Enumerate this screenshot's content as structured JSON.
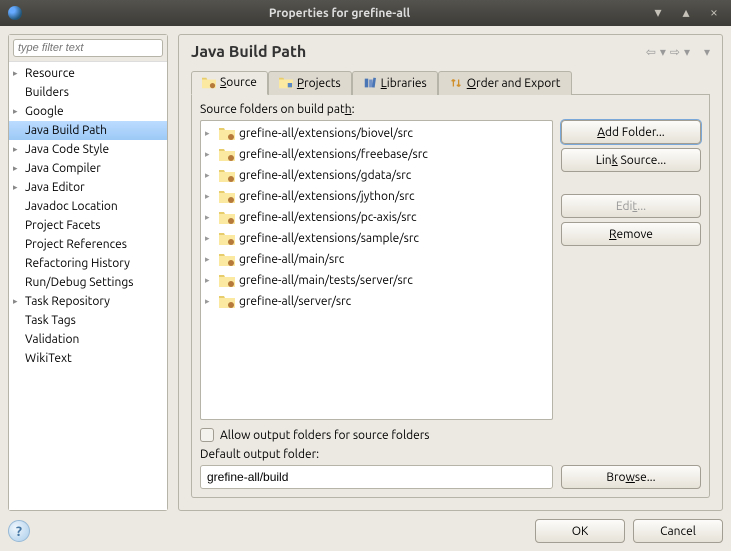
{
  "window": {
    "title": "Properties for grefine-all"
  },
  "filter": {
    "placeholder": "type filter text"
  },
  "sidebar_items": [
    {
      "label": "Resource",
      "expandable": true,
      "selected": false
    },
    {
      "label": "Builders",
      "expandable": false,
      "selected": false
    },
    {
      "label": "Google",
      "expandable": true,
      "selected": false
    },
    {
      "label": "Java Build Path",
      "expandable": false,
      "selected": true
    },
    {
      "label": "Java Code Style",
      "expandable": true,
      "selected": false
    },
    {
      "label": "Java Compiler",
      "expandable": true,
      "selected": false
    },
    {
      "label": "Java Editor",
      "expandable": true,
      "selected": false
    },
    {
      "label": "Javadoc Location",
      "expandable": false,
      "selected": false
    },
    {
      "label": "Project Facets",
      "expandable": false,
      "selected": false
    },
    {
      "label": "Project References",
      "expandable": false,
      "selected": false
    },
    {
      "label": "Refactoring History",
      "expandable": false,
      "selected": false
    },
    {
      "label": "Run/Debug Settings",
      "expandable": false,
      "selected": false
    },
    {
      "label": "Task Repository",
      "expandable": true,
      "selected": false
    },
    {
      "label": "Task Tags",
      "expandable": false,
      "selected": false
    },
    {
      "label": "Validation",
      "expandable": false,
      "selected": false
    },
    {
      "label": "WikiText",
      "expandable": false,
      "selected": false
    }
  ],
  "heading": "Java Build Path",
  "tabs": [
    {
      "icon": "source",
      "pre": "",
      "u": "S",
      "post": "ource",
      "active": true
    },
    {
      "icon": "projects",
      "pre": "",
      "u": "P",
      "post": "rojects",
      "active": false
    },
    {
      "icon": "libraries",
      "pre": "",
      "u": "L",
      "post": "ibraries",
      "active": false
    },
    {
      "icon": "order",
      "pre": "",
      "u": "O",
      "post": "rder and Export",
      "active": false
    }
  ],
  "source_label_pre": "Source folders on build pat",
  "source_label_u": "h",
  "source_label_post": ":",
  "source_folders": [
    "grefine-all/extensions/biovel/src",
    "grefine-all/extensions/freebase/src",
    "grefine-all/extensions/gdata/src",
    "grefine-all/extensions/jython/src",
    "grefine-all/extensions/pc-axis/src",
    "grefine-all/extensions/sample/src",
    "grefine-all/main/src",
    "grefine-all/main/tests/server/src",
    "grefine-all/server/src"
  ],
  "buttons": {
    "add_folder": {
      "pre": "",
      "u": "A",
      "post": "dd Folder..."
    },
    "link_source": {
      "pre": "Lin",
      "u": "k",
      "post": " Source..."
    },
    "edit": {
      "pre": "Edi",
      "u": "t",
      "post": "..."
    },
    "remove": {
      "pre": "",
      "u": "R",
      "post": "emove"
    },
    "browse": {
      "pre": "Bro",
      "u": "w",
      "post": "se..."
    }
  },
  "allow_output_pre": "Allow output folders for sour",
  "allow_output_u": "c",
  "allow_output_post": "e folders",
  "default_out_pre": "",
  "default_out_u": "D",
  "default_out_post": "efault output folder:",
  "default_out_value": "grefine-all/build",
  "footer": {
    "ok": "OK",
    "cancel": "Cancel",
    "help": "?"
  }
}
